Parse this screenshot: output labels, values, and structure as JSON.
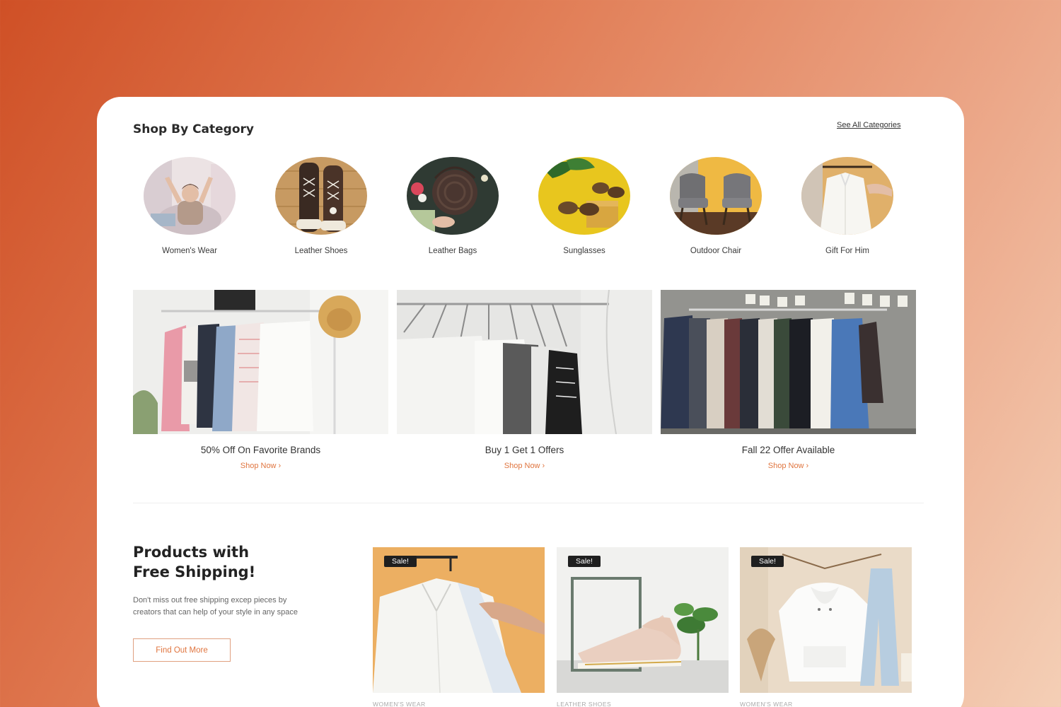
{
  "section_title": "Shop By Category",
  "see_all_label": "See All Categories",
  "categories": [
    {
      "label": "Women's Wear"
    },
    {
      "label": "Leather Shoes"
    },
    {
      "label": "Leather Bags"
    },
    {
      "label": "Sunglasses"
    },
    {
      "label": "Outdoor Chair"
    },
    {
      "label": "Gift For Him"
    }
  ],
  "banners": [
    {
      "title": "50% Off On Favorite Brands",
      "cta": "Shop Now ›"
    },
    {
      "title": "Buy 1 Get 1 Offers",
      "cta": "Shop Now ›"
    },
    {
      "title": "Fall 22 Offer Available",
      "cta": "Shop Now ›"
    }
  ],
  "promo": {
    "title_line1": "Products with",
    "title_line2": "Free Shipping!",
    "desc_line1": "Don't miss out free shipping excep pieces by",
    "desc_line2": "creators that can help of your style in any space",
    "button": "Find Out More"
  },
  "products": [
    {
      "badge": "Sale!",
      "category": "WOMEN'S WEAR"
    },
    {
      "badge": "Sale!",
      "category": "LEATHER SHOES"
    },
    {
      "badge": "Sale!",
      "category": "WOMEN'S WEAR"
    }
  ],
  "colors": {
    "accent": "#e0753f",
    "background_start": "#cf5026",
    "background_end": "#f4cfb6",
    "badge": "#1f1f1f"
  }
}
